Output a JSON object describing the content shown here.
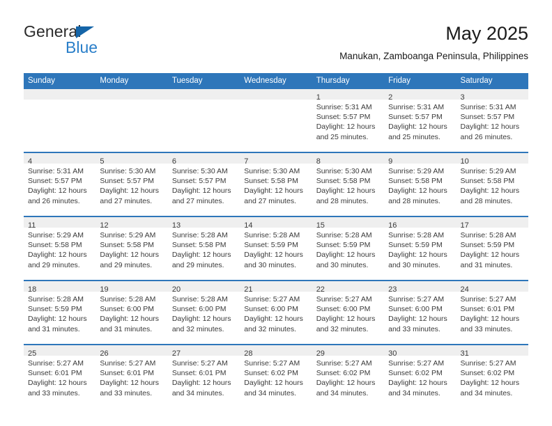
{
  "logo": {
    "word_dark": "General",
    "word_blue": "Blue",
    "triangle": "triangle-icon",
    "dark_color": "#2b2b2b",
    "blue_color": "#2a7fc9",
    "triangle_color": "#1565a8"
  },
  "header": {
    "title": "May 2025",
    "subtitle": "Manukan, Zamboanga Peninsula, Philippines"
  },
  "theme": {
    "header_blue": "#2e76ba",
    "daynum_band": "#efefef",
    "text": "#3a3a3a"
  },
  "calendar": {
    "weekday_headers": [
      "Sunday",
      "Monday",
      "Tuesday",
      "Wednesday",
      "Thursday",
      "Friday",
      "Saturday"
    ],
    "weeks": [
      [
        {
          "day": "",
          "lines": []
        },
        {
          "day": "",
          "lines": []
        },
        {
          "day": "",
          "lines": []
        },
        {
          "day": "",
          "lines": []
        },
        {
          "day": "1",
          "lines": [
            "Sunrise: 5:31 AM",
            "Sunset: 5:57 PM",
            "Daylight: 12 hours",
            "and 25 minutes."
          ]
        },
        {
          "day": "2",
          "lines": [
            "Sunrise: 5:31 AM",
            "Sunset: 5:57 PM",
            "Daylight: 12 hours",
            "and 25 minutes."
          ]
        },
        {
          "day": "3",
          "lines": [
            "Sunrise: 5:31 AM",
            "Sunset: 5:57 PM",
            "Daylight: 12 hours",
            "and 26 minutes."
          ]
        }
      ],
      [
        {
          "day": "4",
          "lines": [
            "Sunrise: 5:31 AM",
            "Sunset: 5:57 PM",
            "Daylight: 12 hours",
            "and 26 minutes."
          ]
        },
        {
          "day": "5",
          "lines": [
            "Sunrise: 5:30 AM",
            "Sunset: 5:57 PM",
            "Daylight: 12 hours",
            "and 27 minutes."
          ]
        },
        {
          "day": "6",
          "lines": [
            "Sunrise: 5:30 AM",
            "Sunset: 5:57 PM",
            "Daylight: 12 hours",
            "and 27 minutes."
          ]
        },
        {
          "day": "7",
          "lines": [
            "Sunrise: 5:30 AM",
            "Sunset: 5:58 PM",
            "Daylight: 12 hours",
            "and 27 minutes."
          ]
        },
        {
          "day": "8",
          "lines": [
            "Sunrise: 5:30 AM",
            "Sunset: 5:58 PM",
            "Daylight: 12 hours",
            "and 28 minutes."
          ]
        },
        {
          "day": "9",
          "lines": [
            "Sunrise: 5:29 AM",
            "Sunset: 5:58 PM",
            "Daylight: 12 hours",
            "and 28 minutes."
          ]
        },
        {
          "day": "10",
          "lines": [
            "Sunrise: 5:29 AM",
            "Sunset: 5:58 PM",
            "Daylight: 12 hours",
            "and 28 minutes."
          ]
        }
      ],
      [
        {
          "day": "11",
          "lines": [
            "Sunrise: 5:29 AM",
            "Sunset: 5:58 PM",
            "Daylight: 12 hours",
            "and 29 minutes."
          ]
        },
        {
          "day": "12",
          "lines": [
            "Sunrise: 5:29 AM",
            "Sunset: 5:58 PM",
            "Daylight: 12 hours",
            "and 29 minutes."
          ]
        },
        {
          "day": "13",
          "lines": [
            "Sunrise: 5:28 AM",
            "Sunset: 5:58 PM",
            "Daylight: 12 hours",
            "and 29 minutes."
          ]
        },
        {
          "day": "14",
          "lines": [
            "Sunrise: 5:28 AM",
            "Sunset: 5:59 PM",
            "Daylight: 12 hours",
            "and 30 minutes."
          ]
        },
        {
          "day": "15",
          "lines": [
            "Sunrise: 5:28 AM",
            "Sunset: 5:59 PM",
            "Daylight: 12 hours",
            "and 30 minutes."
          ]
        },
        {
          "day": "16",
          "lines": [
            "Sunrise: 5:28 AM",
            "Sunset: 5:59 PM",
            "Daylight: 12 hours",
            "and 30 minutes."
          ]
        },
        {
          "day": "17",
          "lines": [
            "Sunrise: 5:28 AM",
            "Sunset: 5:59 PM",
            "Daylight: 12 hours",
            "and 31 minutes."
          ]
        }
      ],
      [
        {
          "day": "18",
          "lines": [
            "Sunrise: 5:28 AM",
            "Sunset: 5:59 PM",
            "Daylight: 12 hours",
            "and 31 minutes."
          ]
        },
        {
          "day": "19",
          "lines": [
            "Sunrise: 5:28 AM",
            "Sunset: 6:00 PM",
            "Daylight: 12 hours",
            "and 31 minutes."
          ]
        },
        {
          "day": "20",
          "lines": [
            "Sunrise: 5:28 AM",
            "Sunset: 6:00 PM",
            "Daylight: 12 hours",
            "and 32 minutes."
          ]
        },
        {
          "day": "21",
          "lines": [
            "Sunrise: 5:27 AM",
            "Sunset: 6:00 PM",
            "Daylight: 12 hours",
            "and 32 minutes."
          ]
        },
        {
          "day": "22",
          "lines": [
            "Sunrise: 5:27 AM",
            "Sunset: 6:00 PM",
            "Daylight: 12 hours",
            "and 32 minutes."
          ]
        },
        {
          "day": "23",
          "lines": [
            "Sunrise: 5:27 AM",
            "Sunset: 6:00 PM",
            "Daylight: 12 hours",
            "and 33 minutes."
          ]
        },
        {
          "day": "24",
          "lines": [
            "Sunrise: 5:27 AM",
            "Sunset: 6:01 PM",
            "Daylight: 12 hours",
            "and 33 minutes."
          ]
        }
      ],
      [
        {
          "day": "25",
          "lines": [
            "Sunrise: 5:27 AM",
            "Sunset: 6:01 PM",
            "Daylight: 12 hours",
            "and 33 minutes."
          ]
        },
        {
          "day": "26",
          "lines": [
            "Sunrise: 5:27 AM",
            "Sunset: 6:01 PM",
            "Daylight: 12 hours",
            "and 33 minutes."
          ]
        },
        {
          "day": "27",
          "lines": [
            "Sunrise: 5:27 AM",
            "Sunset: 6:01 PM",
            "Daylight: 12 hours",
            "and 34 minutes."
          ]
        },
        {
          "day": "28",
          "lines": [
            "Sunrise: 5:27 AM",
            "Sunset: 6:02 PM",
            "Daylight: 12 hours",
            "and 34 minutes."
          ]
        },
        {
          "day": "29",
          "lines": [
            "Sunrise: 5:27 AM",
            "Sunset: 6:02 PM",
            "Daylight: 12 hours",
            "and 34 minutes."
          ]
        },
        {
          "day": "30",
          "lines": [
            "Sunrise: 5:27 AM",
            "Sunset: 6:02 PM",
            "Daylight: 12 hours",
            "and 34 minutes."
          ]
        },
        {
          "day": "31",
          "lines": [
            "Sunrise: 5:27 AM",
            "Sunset: 6:02 PM",
            "Daylight: 12 hours",
            "and 34 minutes."
          ]
        }
      ]
    ]
  }
}
